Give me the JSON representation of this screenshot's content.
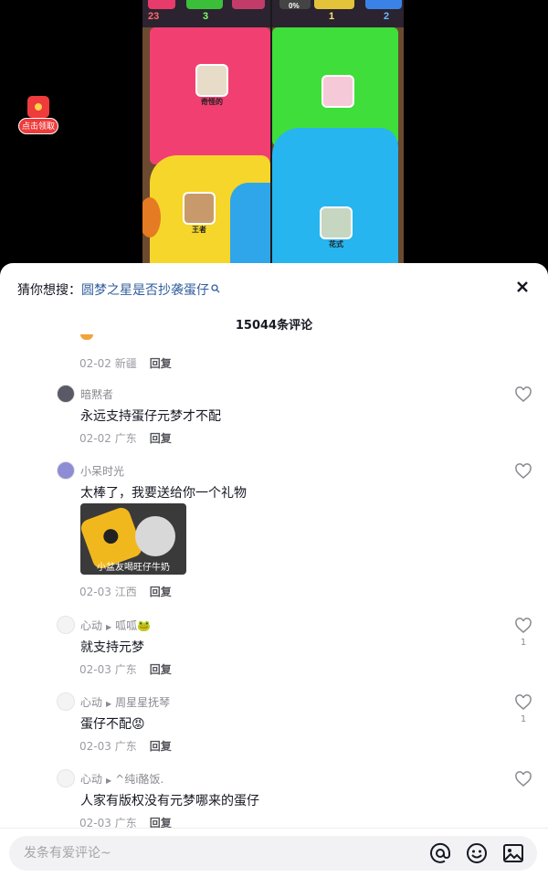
{
  "promo": {
    "label": "点击领取"
  },
  "game": {
    "scores": [
      "23",
      "3",
      "0%",
      "1",
      "2"
    ],
    "players": [
      "奇怪的",
      "",
      "王者",
      "花式"
    ]
  },
  "sheet": {
    "suggest_prefix": "猜你想搜：",
    "suggest_link": "圆梦之星是否抄袭蛋仔",
    "comment_count": "15044条评论"
  },
  "comments": [
    {
      "date": "02-02",
      "region": "新疆",
      "reply": "回复"
    },
    {
      "user": "暗黙者",
      "text": "永远支持蛋仔元梦才不配",
      "date": "02-02",
      "region": "广东",
      "reply": "回复",
      "likes": ""
    },
    {
      "user": "小呆时光",
      "text": "太棒了，我要送给你一个礼物",
      "sticker_caption": "小盆友喝旺仔牛奶",
      "date": "02-03",
      "region": "江西",
      "reply": "回复",
      "likes": ""
    },
    {
      "user": "心动",
      "reply_to": "呱呱🐸",
      "text": "就支持元梦",
      "date": "02-03",
      "region": "广东",
      "reply": "回复",
      "likes": "1"
    },
    {
      "user": "心动",
      "reply_to": "周星星抚琴",
      "text": "蛋仔不配😡",
      "date": "02-03",
      "region": "广东",
      "reply": "回复",
      "likes": "1"
    },
    {
      "user": "心动",
      "reply_to": "^纯i酪饭.",
      "text": "人家有版权没有元梦哪来的蛋仔",
      "date": "02-03",
      "region": "广东",
      "reply": "回复",
      "likes": ""
    }
  ],
  "input": {
    "placeholder": "发条有爱评论~"
  },
  "icons": {
    "close": "close-icon",
    "search": "search-icon",
    "heart": "heart-icon",
    "at": "at-icon",
    "emoji": "emoji-icon",
    "image": "image-icon"
  },
  "colors": {
    "link": "#2f5e9c",
    "meta": "#9a9ba2",
    "promo": "#ef3b3b"
  }
}
